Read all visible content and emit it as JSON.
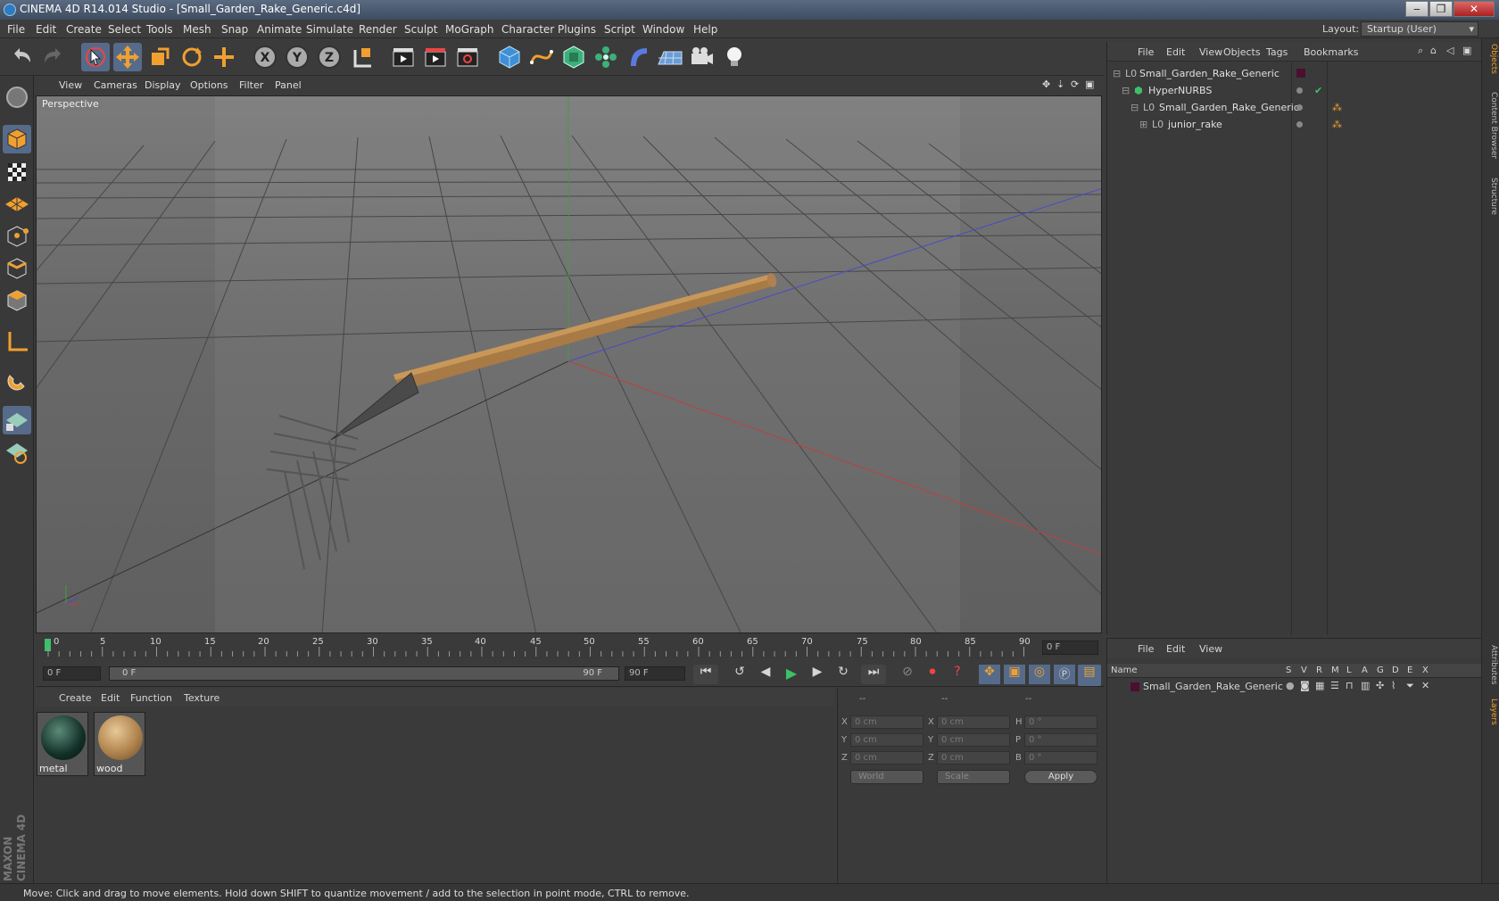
{
  "window": {
    "title": "CINEMA 4D R14.014 Studio - [Small_Garden_Rake_Generic.c4d]",
    "minimize": "‒",
    "maximize": "❐",
    "close": "✕"
  },
  "menubar": {
    "items": [
      "File",
      "Edit",
      "Create",
      "Select",
      "Tools",
      "Mesh",
      "Snap",
      "Animate",
      "Simulate",
      "Render",
      "Sculpt",
      "MoGraph",
      "Character",
      "Plugins",
      "Script",
      "Window",
      "Help"
    ],
    "layout_label": "Layout:",
    "layout_value": "Startup (User)"
  },
  "viewport": {
    "menu": [
      "View",
      "Cameras",
      "Display",
      "Options",
      "Filter",
      "Panel"
    ],
    "label": "Perspective"
  },
  "timeline": {
    "ticks": [
      "0",
      "5",
      "10",
      "15",
      "20",
      "25",
      "30",
      "35",
      "40",
      "45",
      "50",
      "55",
      "60",
      "65",
      "70",
      "75",
      "80",
      "85",
      "90"
    ],
    "current_frame": "0 F"
  },
  "transport": {
    "start_field": "0 F",
    "range_start": "0 F",
    "range_end": "90 F",
    "end_field": "90 F"
  },
  "materials": {
    "menu": [
      "Create",
      "Edit",
      "Function",
      "Texture"
    ],
    "items": [
      {
        "name": "metal"
      },
      {
        "name": "wood"
      }
    ]
  },
  "coordinates": {
    "header": [
      "--",
      "--",
      "--"
    ],
    "rows": [
      {
        "a": "X",
        "av": "0 cm",
        "b": "X",
        "bv": "0 cm",
        "c": "H",
        "cv": "0 °"
      },
      {
        "a": "Y",
        "av": "0 cm",
        "b": "Y",
        "bv": "0 cm",
        "c": "P",
        "cv": "0 °"
      },
      {
        "a": "Z",
        "av": "0 cm",
        "b": "Z",
        "bv": "0 cm",
        "c": "B",
        "cv": "0 °"
      }
    ],
    "world": "World",
    "scale": "Scale",
    "apply": "Apply"
  },
  "object_manager": {
    "menu": [
      "File",
      "Edit",
      "View",
      "Objects",
      "Tags",
      "Bookmarks"
    ],
    "objects": [
      "Small_Garden_Rake_Generic",
      "HyperNURBS",
      "Small_Garden_Rake_Generic",
      "junior_rake"
    ]
  },
  "layer_manager": {
    "menu": [
      "File",
      "Edit",
      "View"
    ],
    "columns": [
      "Name",
      "S",
      "V",
      "R",
      "M",
      "L",
      "A",
      "G",
      "D",
      "E",
      "X"
    ],
    "layer": "Small_Garden_Rake_Generic"
  },
  "right_tabs": [
    "Objects",
    "Content Browser",
    "Structure",
    "Attributes",
    "Layers"
  ],
  "status": "Move: Click and drag to move elements. Hold down SHIFT to quantize movement / add to the selection in point mode, CTRL to remove.",
  "brand": "MAXON CINEMA 4D",
  "colors": {
    "accent": "#f0a030",
    "layer_color": "#4a1030"
  }
}
